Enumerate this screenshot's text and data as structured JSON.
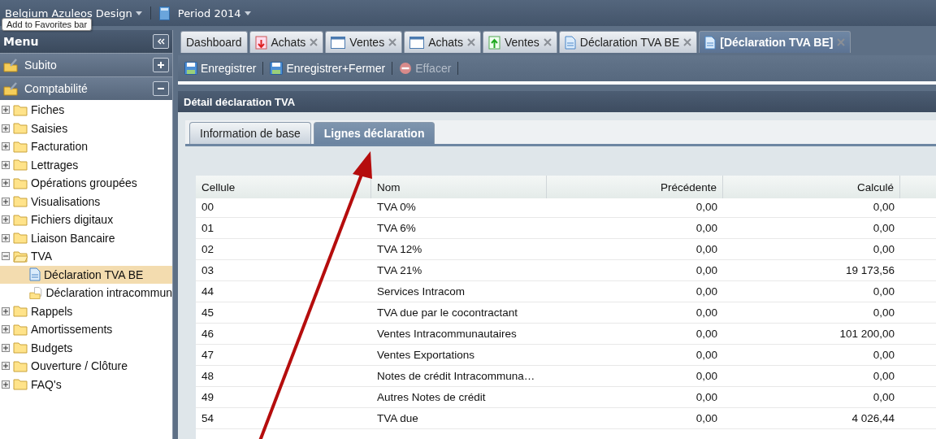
{
  "top_bar": {
    "company": "Belgium Azuleos Design",
    "period": "Period 2014",
    "tooltip": "Add to Favorites bar"
  },
  "sidebar": {
    "title": "Menu",
    "sections": [
      {
        "label": "Subito",
        "expanded": false
      },
      {
        "label": "Comptabilité",
        "expanded": true
      }
    ],
    "tree": [
      {
        "label": "Fiches",
        "expanded": false
      },
      {
        "label": "Saisies",
        "expanded": false
      },
      {
        "label": "Facturation",
        "expanded": false
      },
      {
        "label": "Lettrages",
        "expanded": false
      },
      {
        "label": "Opérations groupées",
        "expanded": false
      },
      {
        "label": "Visualisations",
        "expanded": false
      },
      {
        "label": "Fichiers digitaux",
        "expanded": false
      },
      {
        "label": "Liaison Bancaire",
        "expanded": false
      },
      {
        "label": "TVA",
        "expanded": true,
        "children": [
          {
            "label": "Déclaration TVA BE",
            "kind": "document",
            "selected": true
          },
          {
            "label": "Déclaration intracommun",
            "kind": "folder-document",
            "selected": false
          }
        ]
      },
      {
        "label": "Rappels",
        "expanded": false
      },
      {
        "label": "Amortissements",
        "expanded": false
      },
      {
        "label": "Budgets",
        "expanded": false
      },
      {
        "label": "Ouverture / Clôture",
        "expanded": false
      },
      {
        "label": "FAQ's",
        "expanded": false
      }
    ]
  },
  "tabs": [
    {
      "label": "Dashboard",
      "kind": "plain",
      "closable": false,
      "selected": false
    },
    {
      "label": "Achats",
      "kind": "red",
      "closable": true,
      "selected": false
    },
    {
      "label": "Ventes",
      "kind": "window",
      "closable": true,
      "selected": false
    },
    {
      "label": "Achats",
      "kind": "window",
      "closable": true,
      "selected": false
    },
    {
      "label": "Ventes",
      "kind": "green",
      "closable": true,
      "selected": false
    },
    {
      "label": "Déclaration TVA BE",
      "kind": "document",
      "closable": true,
      "selected": false
    },
    {
      "label": "[Déclaration TVA BE]",
      "kind": "document",
      "closable": true,
      "selected": true
    }
  ],
  "toolbar": [
    {
      "label": "Enregistrer",
      "kind": "save",
      "disabled": false
    },
    {
      "label": "Enregistrer+Fermer",
      "kind": "save",
      "disabled": false
    },
    {
      "label": "Effacer",
      "kind": "delete",
      "disabled": true
    }
  ],
  "panel": {
    "title": "Détail déclaration TVA",
    "tabs": [
      {
        "label": "Information de base",
        "selected": false
      },
      {
        "label": "Lignes déclaration",
        "selected": true
      }
    ]
  },
  "table": {
    "columns": [
      "Cellule",
      "Nom",
      "Précédente",
      "Calculé"
    ],
    "rows": [
      [
        "00",
        "TVA 0%",
        "0,00",
        "0,00"
      ],
      [
        "01",
        "TVA 6%",
        "0,00",
        "0,00"
      ],
      [
        "02",
        "TVA 12%",
        "0,00",
        "0,00"
      ],
      [
        "03",
        "TVA 21%",
        "0,00",
        "19 173,56"
      ],
      [
        "44",
        "Services Intracom",
        "0,00",
        "0,00"
      ],
      [
        "45",
        "TVA due par le cocontractant",
        "0,00",
        "0,00"
      ],
      [
        "46",
        "Ventes Intracommunautaires",
        "0,00",
        "101 200,00"
      ],
      [
        "47",
        "Ventes Exportations",
        "0,00",
        "0,00"
      ],
      [
        "48",
        "Notes de crédit Intracommuna…",
        "0,00",
        "0,00"
      ],
      [
        "49",
        "Autres Notes de crédit",
        "0,00",
        "0,00"
      ],
      [
        "54",
        "TVA due",
        "0,00",
        "4 026,44"
      ]
    ]
  }
}
